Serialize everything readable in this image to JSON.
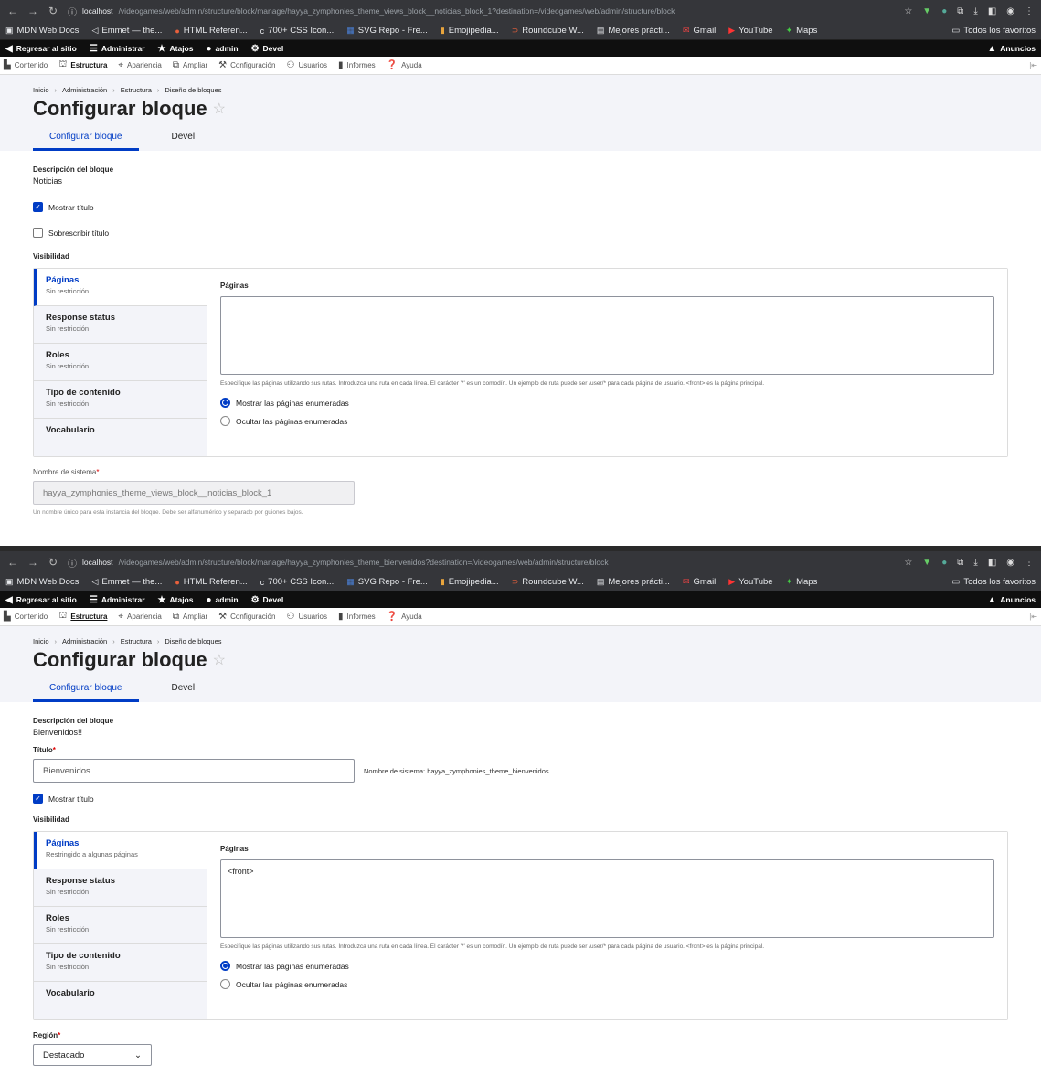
{
  "browser": {
    "bookmarks": [
      "MDN Web Docs",
      "Emmet — the...",
      "HTML Referen...",
      "700+ CSS Icon...",
      "SVG Repo - Fre...",
      "Emojipedia...",
      "Roundcube W...",
      "Mejores prácti...",
      "Gmail",
      "YouTube",
      "Maps"
    ],
    "bookmarks_right": "Todos los favoritos"
  },
  "admin": {
    "toolbar": {
      "back": "Regresar al sitio",
      "manage": "Administrar",
      "shortcuts": "Atajos",
      "user": "admin",
      "devel": "Devel",
      "announcements": "Anuncios"
    },
    "menu": [
      "Contenido",
      "Estructura",
      "Apariencia",
      "Ampliar",
      "Configuración",
      "Usuarios",
      "Informes",
      "Ayuda"
    ]
  },
  "common": {
    "breadcrumb": [
      "Inicio",
      "Administración",
      "Estructura",
      "Diseño de bloques"
    ],
    "page_title": "Configurar bloque",
    "tabs": [
      "Configurar bloque",
      "Devel"
    ],
    "block_desc_label": "Descripción del bloque",
    "show_title": "Mostrar título",
    "visibility": "Visibilidad",
    "pages_label": "Páginas",
    "help": "Especifique las páginas utilizando sus rutas. Introduzca una ruta en cada línea. El carácter '*' es un comodín. Un ejemplo de ruta puede ser /user/* para cada página de usuario. <front> es la página principal.",
    "radio_show": "Mostrar las páginas enumeradas",
    "radio_hide": "Ocultar las páginas enumeradas",
    "no_restriction": "Sin restricción"
  },
  "shot1": {
    "url_host": "localhost",
    "url_path": "/videogames/web/admin/structure/block/manage/hayya_zymphonies_theme_views_block__noticias_block_1?destination=/videogames/web/admin/structure/block",
    "block_desc": "Noticias",
    "override_title": "Sobrescribir título",
    "vt_items": [
      {
        "title": "Páginas",
        "sub": "Sin restricción"
      },
      {
        "title": "Response status",
        "sub": "Sin restricción"
      },
      {
        "title": "Roles",
        "sub": "Sin restricción"
      },
      {
        "title": "Tipo de contenido",
        "sub": "Sin restricción"
      },
      {
        "title": "Vocabulario",
        "sub": ""
      }
    ],
    "pages_value": "",
    "machine_label": "Nombre de sistema",
    "machine_value": "hayya_zymphonies_theme_views_block__noticias_block_1",
    "machine_desc": "Un nombre único para esta instancia del bloque. Debe ser alfanumérico y separado por guiones bajos."
  },
  "shot2": {
    "url_host": "localhost",
    "url_path": "/videogames/web/admin/structure/block/manage/hayya_zymphonies_theme_bienvenidos?destination=/videogames/web/admin/structure/block",
    "block_desc": "Bienvenidos!!",
    "title_label": "Título",
    "title_value": "Bienvenidos",
    "machine_note": "Nombre de sistema: hayya_zymphonies_theme_bienvenidos",
    "vt_items": [
      {
        "title": "Páginas",
        "sub": "Restringido a algunas páginas"
      },
      {
        "title": "Response status",
        "sub": "Sin restricción"
      },
      {
        "title": "Roles",
        "sub": "Sin restricción"
      },
      {
        "title": "Tipo de contenido",
        "sub": "Sin restricción"
      },
      {
        "title": "Vocabulario",
        "sub": ""
      }
    ],
    "pages_value": "<front>",
    "region_label": "Región",
    "region_value": "Destacado"
  },
  "colors": {
    "accent": "#003cc5",
    "toolbar": "#0f0f0f",
    "browser": "#35363a"
  }
}
